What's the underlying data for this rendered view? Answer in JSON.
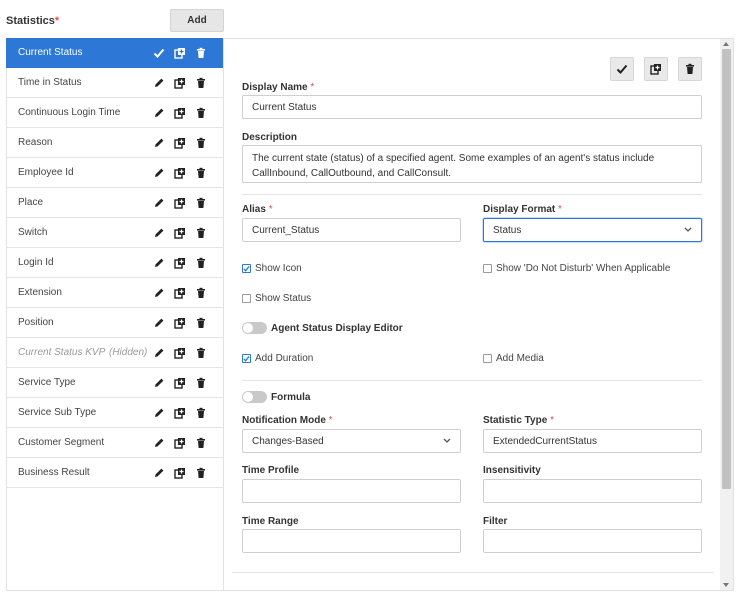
{
  "header": {
    "title": "Statistics",
    "required_mark": "*",
    "add_label": "Add"
  },
  "sidebar": {
    "items": [
      {
        "label": "Current Status",
        "active": true
      },
      {
        "label": "Time in Status"
      },
      {
        "label": "Continuous Login Time"
      },
      {
        "label": "Reason"
      },
      {
        "label": "Employee Id"
      },
      {
        "label": "Place"
      },
      {
        "label": "Switch"
      },
      {
        "label": "Login Id"
      },
      {
        "label": "Extension"
      },
      {
        "label": "Position"
      },
      {
        "label": "Current Status KVP",
        "hidden": true,
        "hidden_tag": "(Hidden)"
      },
      {
        "label": "Service Type"
      },
      {
        "label": "Service Sub Type"
      },
      {
        "label": "Customer Segment"
      },
      {
        "label": "Business Result"
      }
    ]
  },
  "form": {
    "display_name": {
      "label": "Display Name",
      "req": "*",
      "value": "Current Status"
    },
    "description": {
      "label": "Description",
      "value": "The current state (status) of a specified agent. Some examples of an agent's status include CallInbound, CallOutbound, and CallConsult."
    },
    "alias": {
      "label": "Alias",
      "req": "*",
      "value": "Current_Status"
    },
    "display_format": {
      "label": "Display Format",
      "req": "*",
      "value": "Status"
    },
    "show_icon": {
      "label": "Show Icon",
      "checked": true
    },
    "show_dnd": {
      "label": "Show 'Do Not Disturb' When Applicable",
      "checked": false
    },
    "show_status": {
      "label": "Show Status",
      "checked": false
    },
    "agent_status_editor": {
      "label": "Agent Status Display Editor",
      "on": false
    },
    "add_duration": {
      "label": "Add Duration",
      "checked": true
    },
    "add_media": {
      "label": "Add Media",
      "checked": false
    },
    "formula": {
      "label": "Formula",
      "on": false
    },
    "notification_mode": {
      "label": "Notification Mode",
      "req": "*",
      "value": "Changes-Based"
    },
    "statistic_type": {
      "label": "Statistic Type",
      "req": "*",
      "value": "ExtendedCurrentStatus"
    },
    "time_profile": {
      "label": "Time Profile",
      "value": ""
    },
    "insensitivity": {
      "label": "Insensitivity",
      "value": ""
    },
    "time_range": {
      "label": "Time Range",
      "value": ""
    },
    "filter": {
      "label": "Filter",
      "value": ""
    }
  },
  "colors": {
    "accent": "#2d78d6",
    "required": "#d9534f"
  }
}
